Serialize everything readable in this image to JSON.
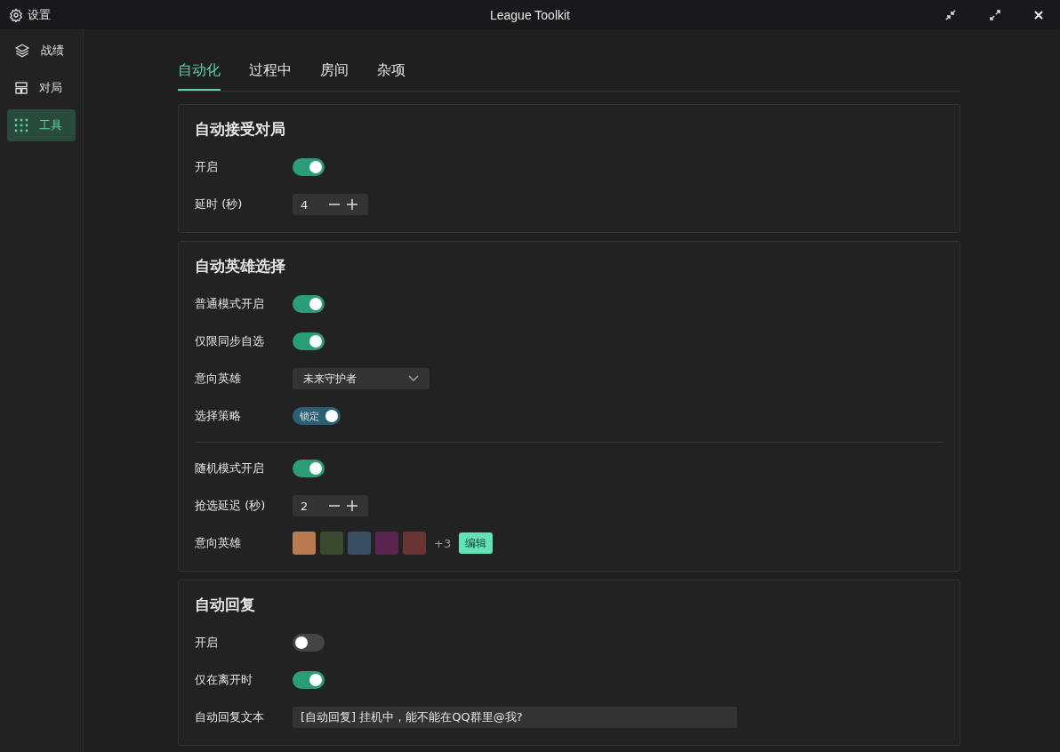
{
  "window": {
    "title": "League Toolkit",
    "settings_label": "设置"
  },
  "sidebar": {
    "items": [
      {
        "label": "战绩",
        "kind": "layers",
        "selected": false
      },
      {
        "label": "对局",
        "kind": "layout",
        "selected": false
      },
      {
        "label": "工具",
        "kind": "grid",
        "selected": true
      }
    ]
  },
  "tabs": [
    {
      "label": "自动化",
      "selected": true
    },
    {
      "label": "过程中",
      "selected": false
    },
    {
      "label": "房间",
      "selected": false
    },
    {
      "label": "杂项",
      "selected": false
    }
  ],
  "sections": [
    {
      "title": "自动接受对局",
      "rows": [
        {
          "kind": "toggle",
          "label": "开启",
          "on": true
        },
        {
          "kind": "number",
          "label": "延时 (秒)",
          "value": "4"
        }
      ]
    },
    {
      "title": "自动英雄选择",
      "rows": [
        {
          "kind": "toggle",
          "label": "普通模式开启",
          "on": true
        },
        {
          "kind": "toggle",
          "label": "仅限同步自选",
          "on": true
        },
        {
          "kind": "select",
          "label": "意向英雄",
          "value": "未来守护者"
        },
        {
          "kind": "labeled-toggle",
          "label": "选择策略",
          "text": "锁定",
          "on": true
        },
        {
          "kind": "divider"
        },
        {
          "kind": "toggle",
          "label": "随机模式开启",
          "on": true
        },
        {
          "kind": "number",
          "label": "抢选延迟 (秒)",
          "value": "2"
        },
        {
          "kind": "champions",
          "label": "意向英雄",
          "portraits": [
            {
              "color": "#b87a4e"
            },
            {
              "color": "#3b4a2c"
            },
            {
              "color": "#3a4e62"
            },
            {
              "color": "#5a2450"
            },
            {
              "color": "#6a3434"
            }
          ],
          "more": "+3",
          "button": "编辑"
        }
      ]
    },
    {
      "title": "自动回复",
      "rows": [
        {
          "kind": "toggle",
          "label": "开启",
          "on": false
        },
        {
          "kind": "toggle",
          "label": "仅在离开时",
          "on": true
        },
        {
          "kind": "text",
          "label": "自动回复文本",
          "value": "[自动回复] 挂机中，能不能在QQ群里@我?"
        }
      ]
    }
  ]
}
